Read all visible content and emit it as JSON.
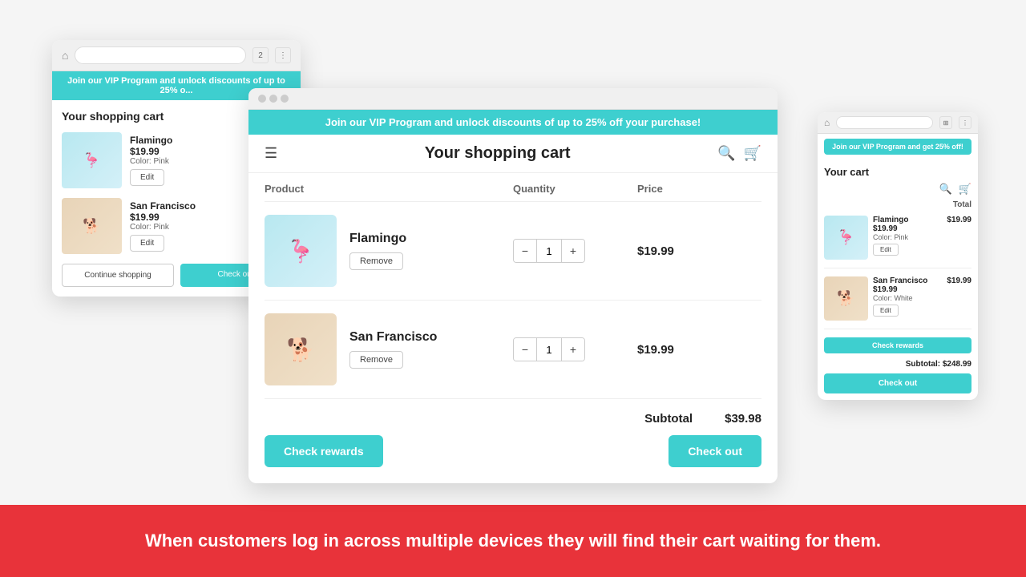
{
  "bottom_banner": {
    "text": "When customers log in across multiple devices they will find their cart waiting for them."
  },
  "left_browser": {
    "vip_banner": "Join our VIP Program and unlock discounts of up to 25% o...",
    "title": "Your shopping cart",
    "products": [
      {
        "name": "Flamingo",
        "price": "$19.99",
        "color": "Color: Pink",
        "edit_label": "Edit",
        "type": "flamingo"
      },
      {
        "name": "San Francisco",
        "price": "$19.99",
        "color": "Color: Pink",
        "edit_label": "Edit",
        "type": "dog"
      }
    ],
    "continue_btn": "Continue shopping",
    "checkout_btn": "Check out"
  },
  "center_browser": {
    "vip_banner": "Join our VIP Program and unlock discounts of up to 25% off your purchase!",
    "title": "Your shopping cart",
    "table": {
      "headers": [
        "Product",
        "Quantity",
        "Price"
      ],
      "rows": [
        {
          "name": "Flamingo",
          "qty": "1",
          "price": "$19.99",
          "remove_label": "Remove",
          "type": "flamingo"
        },
        {
          "name": "San Francisco",
          "qty": "1",
          "price": "$19.99",
          "remove_label": "Remove",
          "type": "dog"
        }
      ],
      "subtotal_label": "Subtotal",
      "subtotal_value": "$39.98"
    },
    "check_rewards_btn": "Check rewards",
    "checkout_btn": "Check out"
  },
  "right_browser": {
    "vip_banner": "Join our VIP Program and get 25% off!",
    "title": "Your cart",
    "total_label": "Total",
    "products": [
      {
        "name": "Flamingo",
        "price": "$19.99",
        "detail_price": "$19.99",
        "color": "Color: Pink",
        "edit_label": "Edit",
        "type": "flamingo"
      },
      {
        "name": "San Francisco",
        "price": "$19.99",
        "detail_price": "$19.99",
        "color": "Color: White",
        "edit_label": "Edit",
        "type": "dog"
      }
    ],
    "check_rewards_btn": "Check rewards",
    "subtotal_label": "Subtotal:",
    "subtotal_value": "$248.99",
    "checkout_btn": "Check out"
  }
}
